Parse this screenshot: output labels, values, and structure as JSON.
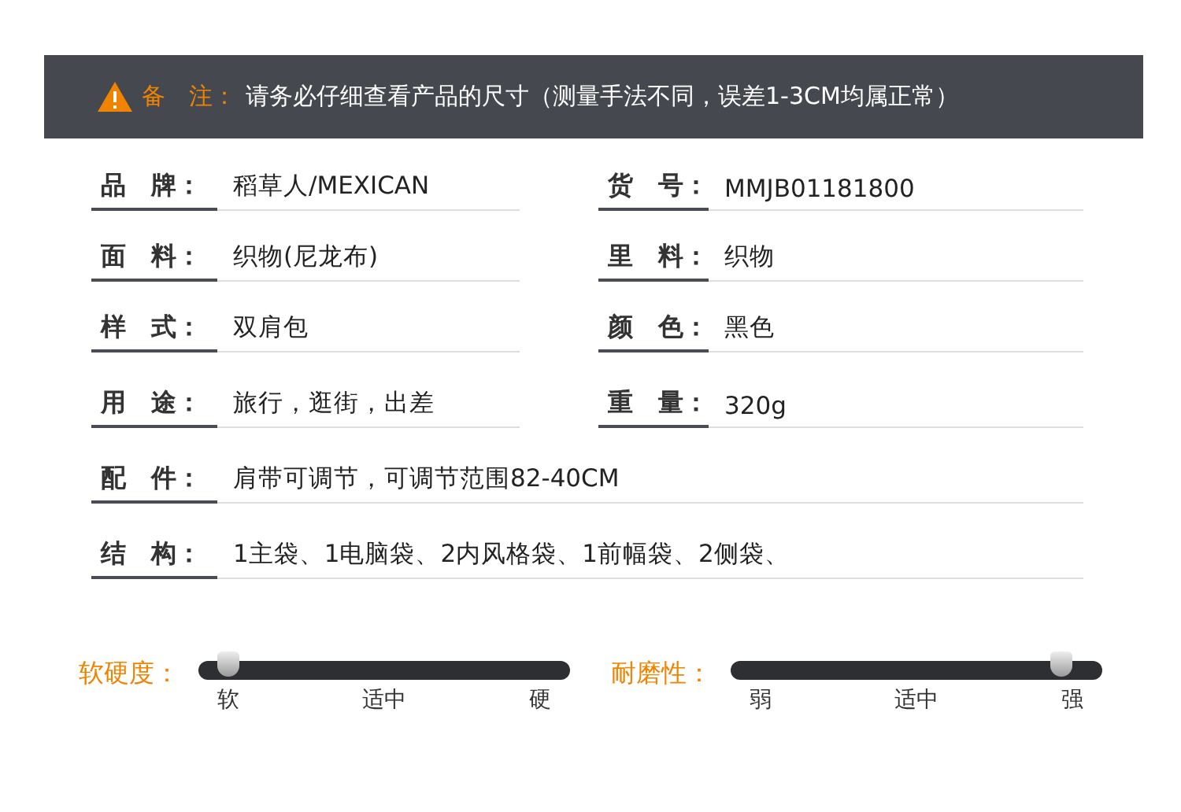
{
  "notice": {
    "label": "备　注：",
    "text": "请务必仔细查看产品的尺寸（测量手法不同，误差1-3CM均属正常）"
  },
  "rows": [
    {
      "kind": "pair",
      "fields": [
        {
          "label": "品　牌：",
          "value": "稻草人/MEXICAN"
        },
        {
          "label": "货　号：",
          "value": "MMJB01181800"
        }
      ]
    },
    {
      "kind": "pair",
      "fields": [
        {
          "label": "面　料：",
          "value": "织物(尼龙布)"
        },
        {
          "label": "里　料：",
          "value": "织物"
        }
      ]
    },
    {
      "kind": "pair",
      "fields": [
        {
          "label": "样　式：",
          "value": "双肩包"
        },
        {
          "label": "颜　色：",
          "value": "黑色"
        }
      ]
    },
    {
      "kind": "pair",
      "fields": [
        {
          "label": "用　途：",
          "value": "旅行，逛街，出差"
        },
        {
          "label": "重　量：",
          "value": "320g"
        }
      ]
    },
    {
      "kind": "wide",
      "fields": [
        {
          "label": "配　件：",
          "value": "肩带可调节，可调节范围82-40CM"
        }
      ]
    },
    {
      "kind": "wide",
      "fields": [
        {
          "label": "结　构：",
          "value": "1主袋、1电脑袋、2内风格袋、1前幅袋、2侧袋、"
        }
      ]
    }
  ],
  "sliders": [
    {
      "label": "软硬度：",
      "level": 0.08,
      "ticks": [
        "软",
        "适中",
        "硬"
      ]
    },
    {
      "label": "耐磨性：",
      "level": 0.89,
      "ticks": [
        "弱",
        "适中",
        "强"
      ]
    }
  ]
}
